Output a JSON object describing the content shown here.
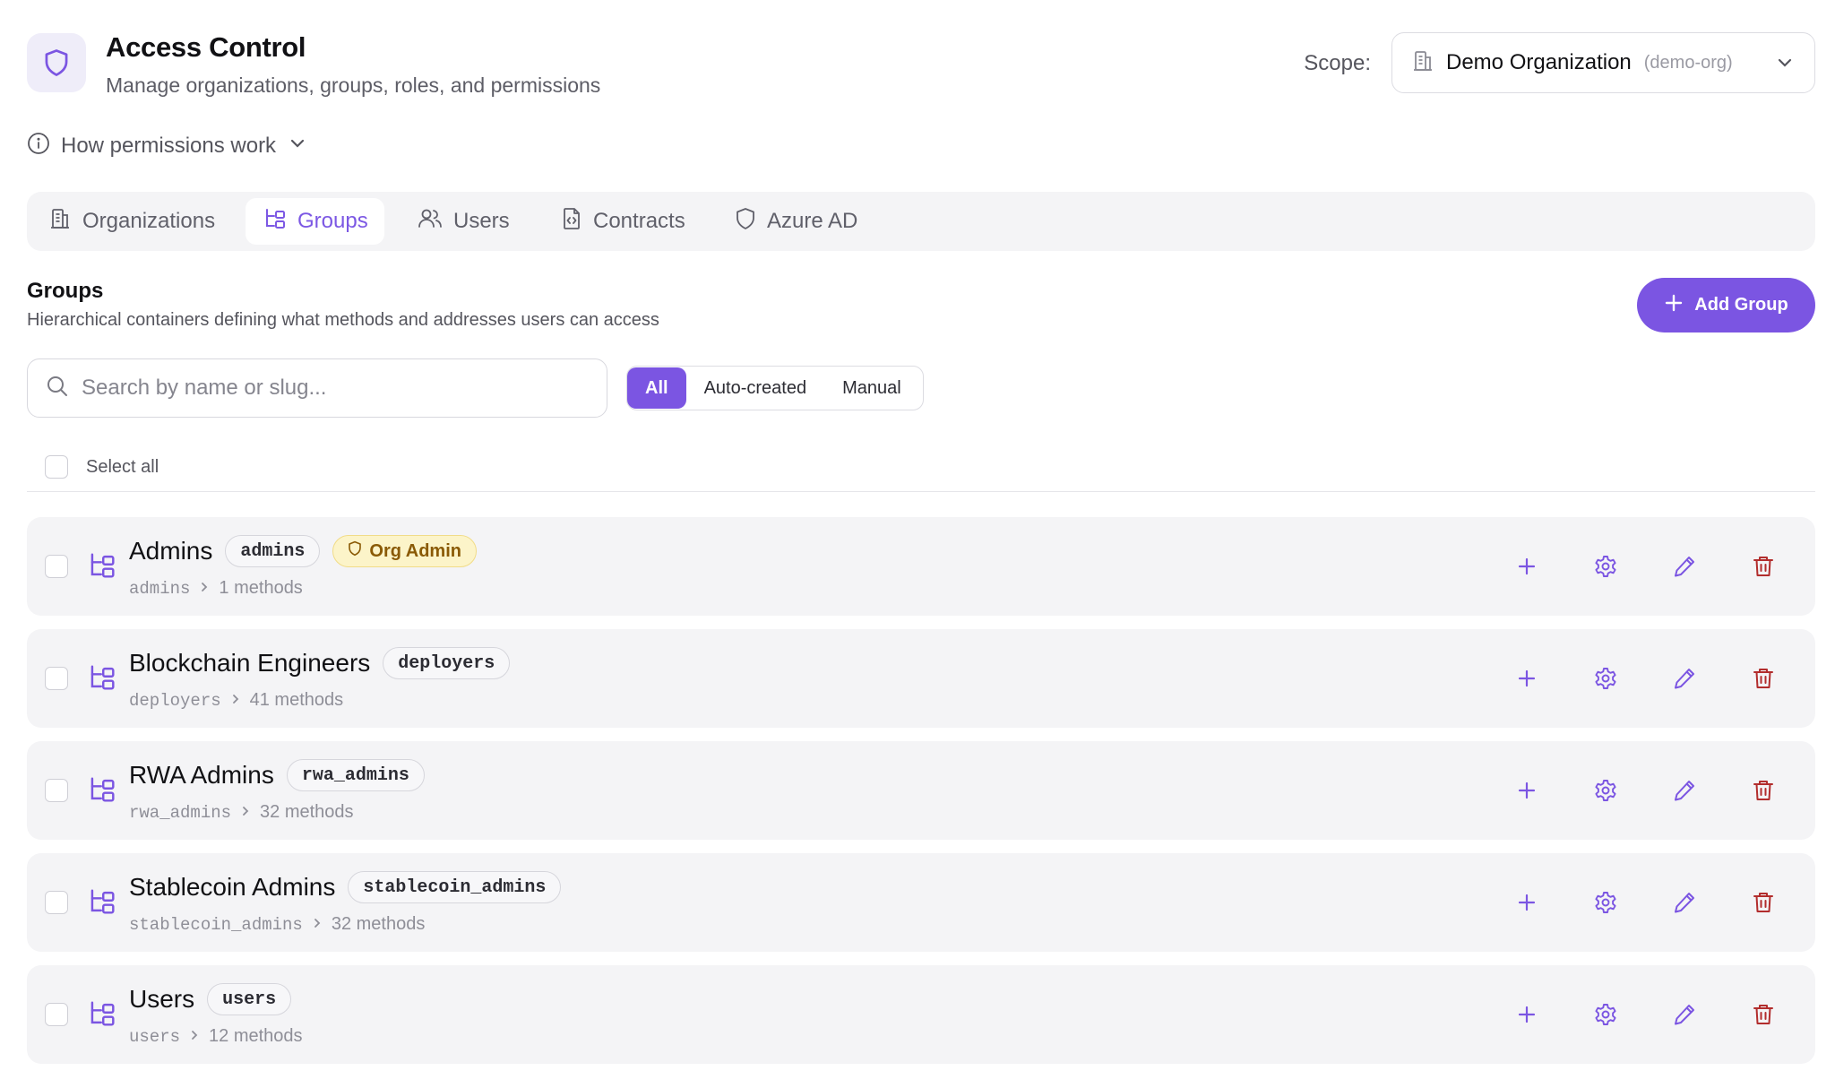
{
  "header": {
    "title": "Access Control",
    "subtitle": "Manage organizations, groups, roles, and permissions",
    "scope_label": "Scope:",
    "scope_name": "Demo Organization",
    "scope_slug": "(demo-org)"
  },
  "help": {
    "label": "How permissions work"
  },
  "tabs": [
    {
      "label": "Organizations",
      "icon": "building-icon"
    },
    {
      "label": "Groups",
      "icon": "hierarchy-icon",
      "active": true
    },
    {
      "label": "Users",
      "icon": "users-icon"
    },
    {
      "label": "Contracts",
      "icon": "file-code-icon"
    },
    {
      "label": "Azure AD",
      "icon": "shield-icon"
    }
  ],
  "section": {
    "title": "Groups",
    "description": "Hierarchical containers defining what methods and addresses users can access",
    "add_label": "Add Group"
  },
  "search": {
    "placeholder": "Search by name or slug...",
    "value": ""
  },
  "filters": [
    {
      "label": "All",
      "active": true
    },
    {
      "label": "Auto-created"
    },
    {
      "label": "Manual"
    }
  ],
  "select_all_label": "Select all",
  "groups": [
    {
      "name": "Admins",
      "slug": "admins",
      "badge": "Org Admin",
      "path_slug": "admins",
      "methods": "1 methods"
    },
    {
      "name": "Blockchain Engineers",
      "slug": "deployers",
      "path_slug": "deployers",
      "methods": "41 methods"
    },
    {
      "name": "RWA Admins",
      "slug": "rwa_admins",
      "path_slug": "rwa_admins",
      "methods": "32 methods"
    },
    {
      "name": "Stablecoin Admins",
      "slug": "stablecoin_admins",
      "path_slug": "stablecoin_admins",
      "methods": "32 methods"
    },
    {
      "name": "Users",
      "slug": "users",
      "path_slug": "users",
      "methods": "12 methods"
    }
  ],
  "colors": {
    "accent": "#7b55e2",
    "danger": "#b22d2d",
    "badge_bg": "#fcf4c9",
    "badge_text": "#8a5a05"
  }
}
